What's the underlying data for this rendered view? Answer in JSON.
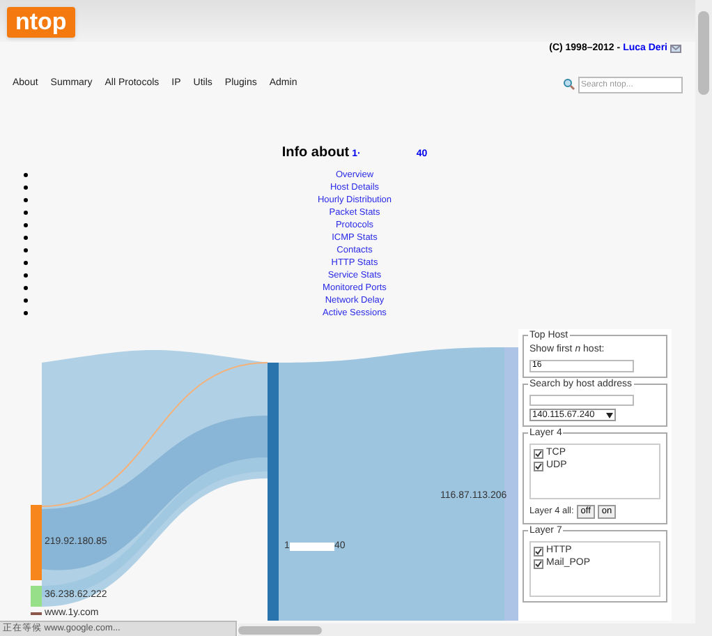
{
  "header": {
    "logo": "ntop",
    "copyright": "(C) 1998–2012 -",
    "author_link": "Luca Deri"
  },
  "nav": [
    "About",
    "Summary",
    "All Protocols",
    "IP",
    "Utils",
    "Plugins",
    "Admin"
  ],
  "search": {
    "placeholder": "Search ntop..."
  },
  "title": {
    "text": "Info about",
    "host_parts": [
      "1·",
      "40"
    ]
  },
  "links": [
    "Overview",
    "Host Details",
    "Hourly Distribution",
    "Packet Stats",
    "Protocols",
    "ICMP Stats",
    "Contacts",
    "HTTP Stats",
    "Service Stats",
    "Monitored Ports",
    "Network Delay",
    "Active Sessions"
  ],
  "sankey": {
    "sources": [
      {
        "label": "219.92.180.85",
        "color": "#f7861c"
      },
      {
        "label": "36.238.62.222",
        "color": "#98df8a"
      },
      {
        "label": "www.1y.com",
        "color": "#8c564b"
      }
    ],
    "center_label_parts": [
      "1",
      "40"
    ],
    "target_label": "116.87.113.206"
  },
  "panel": {
    "top_host": {
      "legend": "Top Host",
      "label": "Show first *n* host:",
      "value": "16"
    },
    "search_host": {
      "legend": "Search by host address",
      "selected": "140.115.67.240"
    },
    "layer4": {
      "legend": "Layer 4",
      "items": [
        {
          "label": "TCP",
          "checked": true
        },
        {
          "label": "UDP",
          "checked": true
        }
      ],
      "all_label": "Layer 4 all:",
      "buttons": [
        "off",
        "on"
      ]
    },
    "layer7": {
      "legend": "Layer 7",
      "items": [
        {
          "label": "HTTP",
          "checked": true
        },
        {
          "label": "Mail_POP",
          "checked": true
        }
      ]
    }
  },
  "status_bar": "正在等候 www.google.com..."
}
